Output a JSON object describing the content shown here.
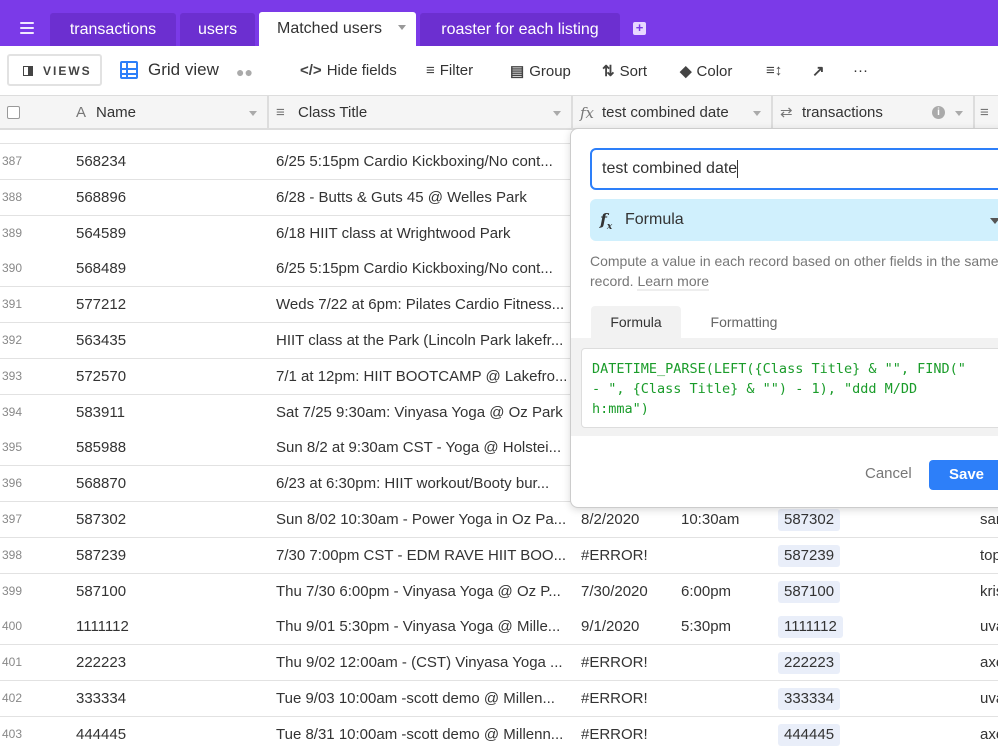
{
  "tabbar": {
    "tabs": [
      {
        "label": "transactions",
        "active": false
      },
      {
        "label": "users",
        "active": false
      },
      {
        "label": "Matched users",
        "active": true
      },
      {
        "label": "roaster for each listing",
        "active": false
      }
    ],
    "brand_color": "#7b3ae8"
  },
  "toolbar": {
    "views_label": "VIEWS",
    "view_name": "Grid view",
    "hide_fields": "Hide fields",
    "filter": "Filter",
    "group": "Group",
    "sort": "Sort",
    "color": "Color",
    "more": "···"
  },
  "columns": {
    "name": "Name",
    "class_title": "Class Title",
    "test_combined_date": "test combined date",
    "transactions": "transactions"
  },
  "rows": [
    {
      "num": "387",
      "name": "568234",
      "title": "6/25 5:15pm Cardio Kickboxing/No cont...",
      "date": "",
      "time": "",
      "transaction": "",
      "extra": ""
    },
    {
      "num": "388",
      "name": "568896",
      "title": "6/28 - Butts & Guts 45 @ Welles Park",
      "date": "",
      "time": "",
      "transaction": "",
      "extra": ""
    },
    {
      "num": "389",
      "name": "564589",
      "title": "6/18 HIIT class at Wrightwood Park",
      "date": "",
      "time": "",
      "transaction": "",
      "extra": ""
    },
    {
      "num": "390",
      "name": "568489",
      "title": "6/25 5:15pm Cardio Kickboxing/No cont...",
      "date": "",
      "time": "",
      "transaction": "",
      "extra": ""
    },
    {
      "num": "391",
      "name": "577212",
      "title": "Weds 7/22 at 6pm: Pilates Cardio Fitness...",
      "date": "",
      "time": "",
      "transaction": "",
      "extra": ""
    },
    {
      "num": "392",
      "name": "563435",
      "title": "HIIT class at the Park (Lincoln Park lakefr...",
      "date": "",
      "time": "",
      "transaction": "",
      "extra": ""
    },
    {
      "num": "393",
      "name": "572570",
      "title": "7/1 at 12pm: HIIT BOOTCAMP @ Lakefro...",
      "date": "",
      "time": "",
      "transaction": "",
      "extra": ""
    },
    {
      "num": "394",
      "name": "583911",
      "title": "Sat 7/25 9:30am: Vinyasa Yoga @ Oz Park",
      "date": "",
      "time": "",
      "transaction": "",
      "extra": ""
    },
    {
      "num": "395",
      "name": "585988",
      "title": "Sun 8/2 at 9:30am CST - Yoga @ Holstei...",
      "date": "",
      "time": "",
      "transaction": "",
      "extra": ""
    },
    {
      "num": "396",
      "name": "568870",
      "title": "6/23 at 6:30pm: HIIT workout/Booty bur...",
      "date": "",
      "time": "",
      "transaction": "",
      "extra": ""
    },
    {
      "num": "397",
      "name": "587302",
      "title": "Sun 8/02 10:30am - Power Yoga in Oz Pa...",
      "date": "8/2/2020",
      "time": "10:30am",
      "transaction": "587302",
      "extra": "sar"
    },
    {
      "num": "398",
      "name": "587239",
      "title": "7/30 7:00pm CST - EDM RAVE HIIT BOO...",
      "date": "#ERROR!",
      "time": "",
      "transaction": "587239",
      "extra": "top"
    },
    {
      "num": "399",
      "name": "587100",
      "title": "Thu 7/30 6:00pm - Vinyasa Yoga @ Oz P...",
      "date": "7/30/2020",
      "time": "6:00pm",
      "transaction": "587100",
      "extra": "kris"
    },
    {
      "num": "400",
      "name": "1111112",
      "title": "Thu 9/01 5:30pm - Vinyasa Yoga @ Mille...",
      "date": "9/1/2020",
      "time": "5:30pm",
      "transaction": "1111112",
      "extra": "uva"
    },
    {
      "num": "401",
      "name": "222223",
      "title": "Thu 9/02 12:00am - (CST) Vinyasa Yoga ...",
      "date": "#ERROR!",
      "time": "",
      "transaction": "222223",
      "extra": "axe"
    },
    {
      "num": "402",
      "name": "333334",
      "title": "Tue 9/03 10:00am -scott demo @ Millen...",
      "date": "#ERROR!",
      "time": "",
      "transaction": "333334",
      "extra": "uva"
    },
    {
      "num": "403",
      "name": "444445",
      "title": "Tue 8/31 10:00am -scott demo @ Millenn...",
      "date": "#ERROR!",
      "time": "",
      "transaction": "444445",
      "extra": "axe"
    }
  ],
  "field_editor": {
    "field_name": "test combined date",
    "field_type": "Formula",
    "description": "Compute a value in each record based on other fields in the same record.",
    "learn_more": "Learn more",
    "tabs": [
      "Formula",
      "Formatting"
    ],
    "formula": "DATETIME_PARSE(LEFT({Class Title} & \"\", FIND(\"\n- \", {Class Title} & \"\") - 1), \"ddd M/DD\nh:mma\")",
    "cancel_label": "Cancel",
    "save_label": "Save",
    "accent_color": "#2d7ff9"
  }
}
